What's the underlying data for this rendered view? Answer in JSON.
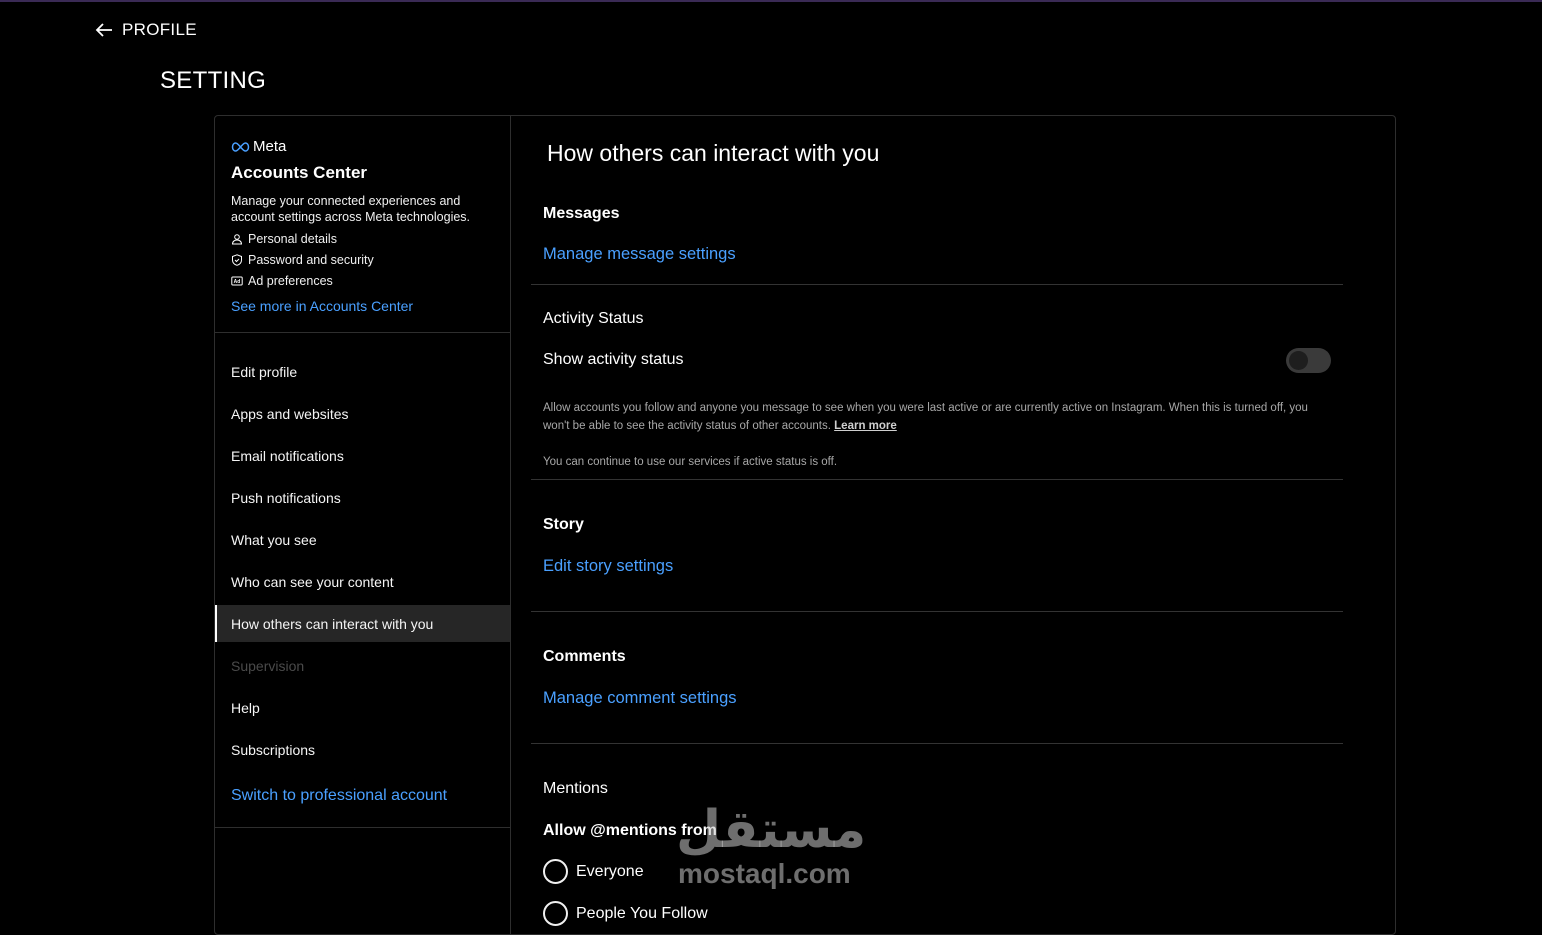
{
  "header": {
    "back_label": "PROFILE",
    "page_title": "SETTING"
  },
  "accounts_center": {
    "brand": "Meta",
    "title": "Accounts Center",
    "description": "Manage your connected experiences and account settings across Meta technologies.",
    "items": [
      {
        "icon": "person-icon",
        "label": "Personal details"
      },
      {
        "icon": "shield-icon",
        "label": "Password and security"
      },
      {
        "icon": "ad-icon",
        "label": "Ad preferences"
      }
    ],
    "see_more": "See more in Accounts Center"
  },
  "nav": {
    "items": [
      {
        "label": "Edit profile",
        "state": "normal"
      },
      {
        "label": "Apps and websites",
        "state": "normal"
      },
      {
        "label": "Email notifications",
        "state": "normal"
      },
      {
        "label": "Push notifications",
        "state": "normal"
      },
      {
        "label": "What you see",
        "state": "normal"
      },
      {
        "label": "Who can see your content",
        "state": "normal"
      },
      {
        "label": "How others can interact with you",
        "state": "active"
      },
      {
        "label": "Supervision",
        "state": "disabled"
      },
      {
        "label": "Help",
        "state": "normal"
      },
      {
        "label": "Subscriptions",
        "state": "normal"
      }
    ],
    "switch_label": "Switch to professional account"
  },
  "main": {
    "title": "How others can interact with you",
    "messages": {
      "heading": "Messages",
      "link": "Manage message settings"
    },
    "activity": {
      "heading": "Activity Status",
      "toggle_label": "Show activity status",
      "toggle_on": false,
      "description": "Allow accounts you follow and anyone you message to see when you were last active or are currently active on Instagram. When this is turned off, you won't be able to see the activity status of other accounts.",
      "learn_more": "Learn more",
      "note": "You can continue to use our services if active status is off."
    },
    "story": {
      "heading": "Story",
      "link": "Edit story settings"
    },
    "comments": {
      "heading": "Comments",
      "link": "Manage comment settings"
    },
    "mentions": {
      "heading": "Mentions",
      "subheading": "Allow @mentions from",
      "options": [
        "Everyone",
        "People You Follow"
      ]
    }
  },
  "watermark": {
    "logo": "مستقل",
    "text": "mostaql.com"
  },
  "colors": {
    "background": "#000000",
    "link": "#4aa0ff",
    "border": "#2e2e2e",
    "active_bg": "#262626"
  }
}
